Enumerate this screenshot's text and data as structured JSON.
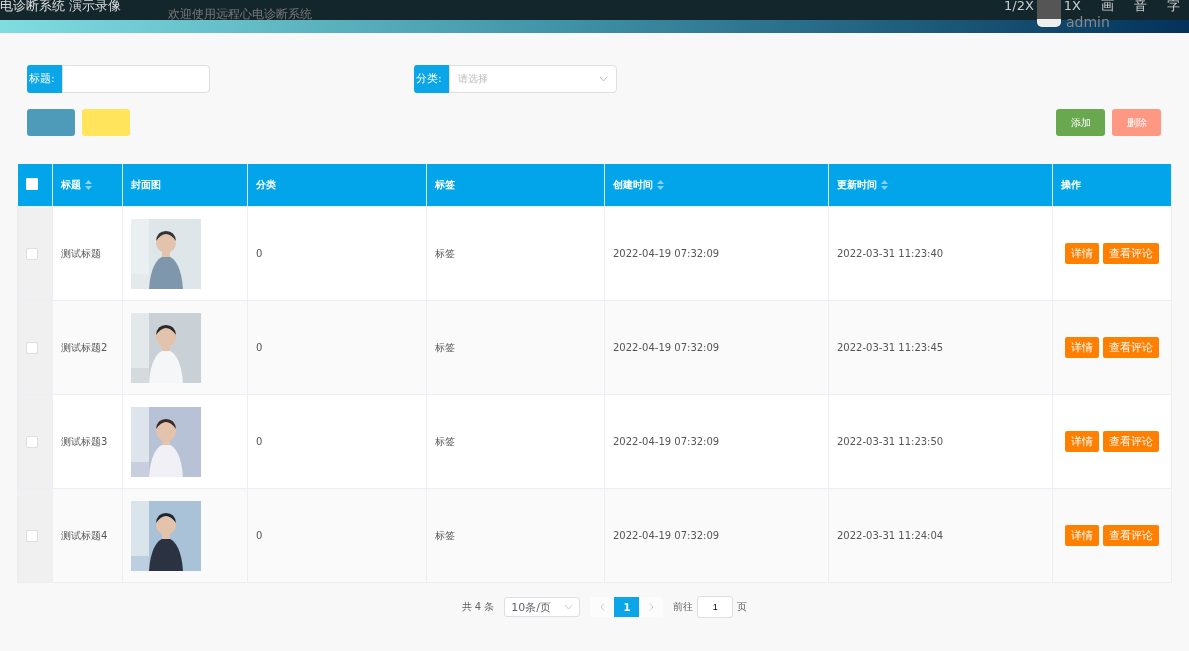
{
  "recording_overlay": {
    "title": "电诊断系统 演示录像",
    "controls": [
      "1/2X",
      "1X",
      "画",
      "音",
      "字"
    ]
  },
  "header": {
    "welcome": "欢迎使用远程心电诊断系统",
    "user": "admin"
  },
  "filters": [
    {
      "label": "标题:",
      "kind": "text"
    },
    {
      "label": "分类:",
      "kind": "select",
      "placeholder": "请选择"
    }
  ],
  "actions": [
    {
      "label": "添加",
      "kind": "add"
    },
    {
      "label": "删除",
      "kind": "delete"
    }
  ],
  "table": {
    "select_all_checked": false,
    "columns": [
      {
        "label": "标题",
        "sortable": true
      },
      {
        "label": "封面图",
        "sortable": false
      },
      {
        "label": "分类",
        "sortable": false
      },
      {
        "label": "标签",
        "sortable": false
      },
      {
        "label": "创建时间",
        "sortable": true
      },
      {
        "label": "更新时间",
        "sortable": true
      },
      {
        "label": "操作",
        "sortable": false
      }
    ],
    "rows": [
      {
        "checked": false,
        "title": "测试标题",
        "category": "0",
        "tag": "标签",
        "created": "2022-04-19 07:32:09",
        "updated": "2022-03-31 11:23:40",
        "buttons": [
          "详情",
          "查看评论"
        ]
      },
      {
        "checked": false,
        "title": "测试标题2",
        "category": "0",
        "tag": "标签",
        "created": "2022-04-19 07:32:09",
        "updated": "2022-03-31 11:23:45",
        "buttons": [
          "详情",
          "查看评论"
        ]
      },
      {
        "checked": false,
        "title": "测试标题3",
        "category": "0",
        "tag": "标签",
        "created": "2022-04-19 07:32:09",
        "updated": "2022-03-31 11:23:50",
        "buttons": [
          "详情",
          "查看评论"
        ]
      },
      {
        "checked": false,
        "title": "测试标题4",
        "category": "0",
        "tag": "标签",
        "created": "2022-04-19 07:32:09",
        "updated": "2022-03-31 11:24:04",
        "buttons": [
          "详情",
          "查看评论"
        ]
      }
    ]
  },
  "pagination": {
    "total": "共 4 条",
    "page_size": "10条/页",
    "pages": [
      {
        "label": "1",
        "selected": true
      }
    ],
    "goto_label": "前往",
    "goto_value": "1",
    "page_suffix": "页"
  }
}
